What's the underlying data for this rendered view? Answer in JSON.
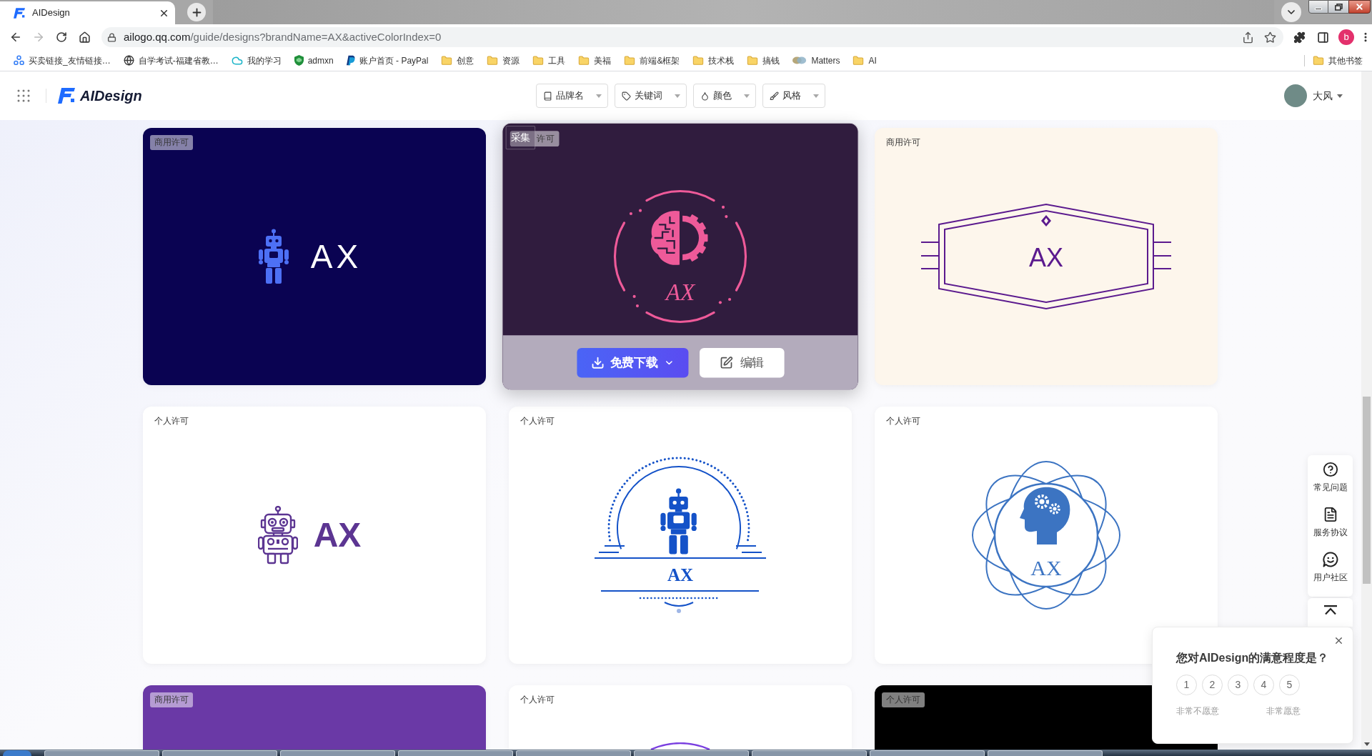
{
  "browser": {
    "tab": {
      "title": "AIDesign",
      "selected": true
    },
    "nav": {
      "back": {
        "disabled": false
      },
      "forward": {
        "disabled": true
      }
    },
    "url": {
      "host": "ailogo.qq.com",
      "path": "/guide/designs?brandName=AX&activeColorIndex=0"
    },
    "profile_initial": "b",
    "bookmarks": [
      {
        "label": "买卖链接_友情链接…",
        "kind": "network"
      },
      {
        "label": "自学考试-福建省教…",
        "kind": "globe"
      },
      {
        "label": "我的学习",
        "kind": "cloud"
      },
      {
        "label": "admxn",
        "kind": "shield"
      },
      {
        "label": "账户首页 - PayPal",
        "kind": "paypal"
      },
      {
        "label": "创意",
        "kind": "folder"
      },
      {
        "label": "资源",
        "kind": "folder"
      },
      {
        "label": "工具",
        "kind": "folder"
      },
      {
        "label": "美福",
        "kind": "folder"
      },
      {
        "label": "前端&框架",
        "kind": "folder"
      },
      {
        "label": "技术栈",
        "kind": "folder"
      },
      {
        "label": "搞钱",
        "kind": "folder"
      },
      {
        "label": "Matters",
        "kind": "matters"
      },
      {
        "label": "AI",
        "kind": "folder"
      }
    ],
    "other_bookmarks": "其他书签"
  },
  "header": {
    "brand": "AIDesign",
    "filters": [
      {
        "label": "品牌名",
        "kind": "brand"
      },
      {
        "label": "关键词",
        "kind": "keyword"
      },
      {
        "label": "颜色",
        "kind": "color"
      },
      {
        "label": "风格",
        "kind": "style"
      }
    ],
    "user": {
      "name": "大风"
    }
  },
  "cards": [
    {
      "license": "商用许可",
      "color": "#0a0352",
      "hovered": false,
      "logo": {
        "kind": "robot",
        "text": "AX"
      }
    },
    {
      "license": "许可",
      "color": "#301c3e",
      "hovered": true,
      "actions": {
        "collect": "采集",
        "download": "免费下载",
        "edit": "编辑"
      },
      "logo": {
        "kind": "brain_gear",
        "text": "AX"
      }
    },
    {
      "license": "商用许可",
      "color": "#fdf6ec",
      "hovered": false,
      "logo": {
        "kind": "hexagon",
        "text": "AX"
      }
    },
    {
      "license": "个人许可",
      "color": "#ffffff",
      "hovered": false,
      "logo": {
        "kind": "robot_outline",
        "text": "AX"
      }
    },
    {
      "license": "个人许可",
      "color": "#ffffff",
      "hovered": false,
      "logo": {
        "kind": "robot_arch",
        "text": "AX"
      }
    },
    {
      "license": "个人许可",
      "color": "#ffffff",
      "hovered": false,
      "logo": {
        "kind": "head_flower",
        "text": "AX"
      }
    },
    {
      "license": "商用许可",
      "color": "#6a39a6",
      "hovered": false
    },
    {
      "license": "个人许可",
      "color": "#ffffff",
      "hovered": false,
      "logo": {
        "kind": "ring_partial"
      }
    },
    {
      "license": "个人许可",
      "color": "#000000",
      "hovered": false
    }
  ],
  "side_tools": [
    {
      "label": "常见问题",
      "kind": "help"
    },
    {
      "label": "服务协议",
      "kind": "agreement"
    },
    {
      "label": "用户社区",
      "kind": "community"
    }
  ],
  "survey": {
    "title": "您对AIDesign的满意程度是？",
    "ratings": [
      {
        "label": "1",
        "selected": false
      },
      {
        "label": "2",
        "selected": false
      },
      {
        "label": "3",
        "selected": false
      },
      {
        "label": "4",
        "selected": false
      },
      {
        "label": "5",
        "selected": false
      }
    ],
    "low_label": "非常不愿意",
    "high_label": "非常愿意"
  }
}
